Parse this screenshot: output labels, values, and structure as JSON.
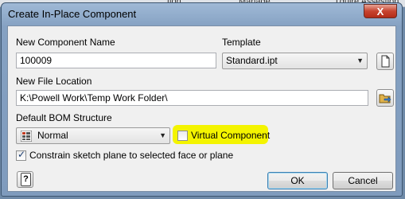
{
  "background_columns": [
    "tion",
    "Manage",
    "Tquire Assestion"
  ],
  "window": {
    "title": "Create In-Place Component",
    "close_glyph": "X"
  },
  "form": {
    "component_name_label": "New Component Name",
    "component_name_value": "100009",
    "template_label": "Template",
    "template_value": "Standard.ipt",
    "file_location_label": "New File Location",
    "file_location_value": "K:\\Powell Work\\Temp Work Folder\\",
    "bom_label": "Default BOM Structure",
    "bom_value": "Normal",
    "virtual_component_label": "Virtual Component",
    "virtual_component_checked": false,
    "constrain_label": "Constrain sketch plane to selected face or plane",
    "constrain_checked": true
  },
  "buttons": {
    "ok": "OK",
    "cancel": "Cancel",
    "help_glyph": "?",
    "checkmark_glyph": "✓",
    "dropdown_glyph": "▼"
  },
  "colors": {
    "highlight": "#f4f400",
    "title_gradient_top": "#9fb9d6",
    "close_button": "#c7432f"
  },
  "icons": [
    "new-template-icon",
    "browse-folder-icon",
    "bom-structure-icon",
    "help-icon"
  ]
}
